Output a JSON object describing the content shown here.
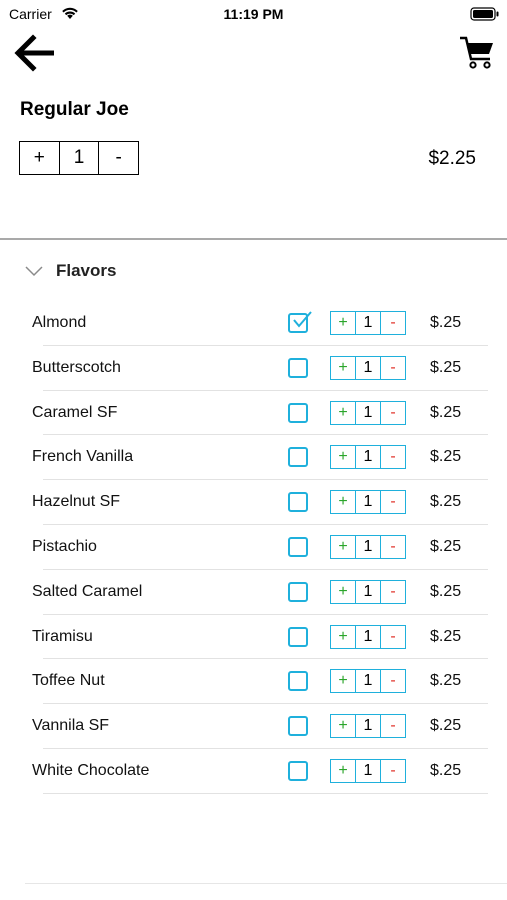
{
  "status_bar": {
    "carrier": "Carrier",
    "time": "11:19 PM"
  },
  "nav": {
    "back_icon": "arrow-left-icon",
    "cart_icon": "shopping-cart-icon"
  },
  "product": {
    "name": "Regular Joe",
    "quantity": {
      "plus": "+",
      "value": "1",
      "minus": "-"
    },
    "price": "$2.25"
  },
  "flavors": {
    "title": "Flavors",
    "expanded": true,
    "items": [
      {
        "name": "Almond",
        "checked": true,
        "plus": "+",
        "qty": "1",
        "minus": "-",
        "price": "$.25"
      },
      {
        "name": "Butterscotch",
        "checked": false,
        "plus": "+",
        "qty": "1",
        "minus": "-",
        "price": "$.25"
      },
      {
        "name": "Caramel SF",
        "checked": false,
        "plus": "+",
        "qty": "1",
        "minus": "-",
        "price": "$.25"
      },
      {
        "name": "French Vanilla",
        "checked": false,
        "plus": "+",
        "qty": "1",
        "minus": "-",
        "price": "$.25"
      },
      {
        "name": "Hazelnut SF",
        "checked": false,
        "plus": "+",
        "qty": "1",
        "minus": "-",
        "price": "$.25"
      },
      {
        "name": "Pistachio",
        "checked": false,
        "plus": "+",
        "qty": "1",
        "minus": "-",
        "price": "$.25"
      },
      {
        "name": "Salted Caramel",
        "checked": false,
        "plus": "+",
        "qty": "1",
        "minus": "-",
        "price": "$.25"
      },
      {
        "name": "Tiramisu",
        "checked": false,
        "plus": "+",
        "qty": "1",
        "minus": "-",
        "price": "$.25"
      },
      {
        "name": "Toffee Nut",
        "checked": false,
        "plus": "+",
        "qty": "1",
        "minus": "-",
        "price": "$.25"
      },
      {
        "name": "Vannila SF",
        "checked": false,
        "plus": "+",
        "qty": "1",
        "minus": "-",
        "price": "$.25"
      },
      {
        "name": "White Chocolate",
        "checked": false,
        "plus": "+",
        "qty": "1",
        "minus": "-",
        "price": "$.25"
      }
    ]
  },
  "colors": {
    "accent": "#1fb0dc",
    "plus": "#2aa52a",
    "minus": "#e0322a"
  }
}
